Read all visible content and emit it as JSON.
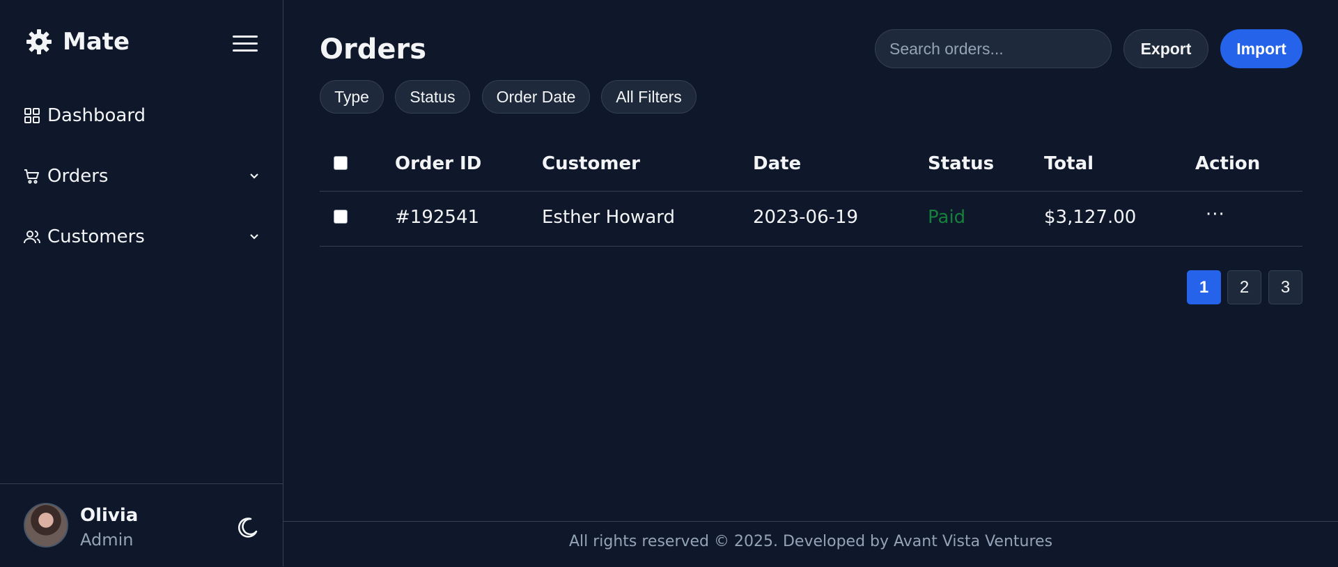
{
  "sidebar": {
    "brand": "Mate",
    "brand_icon": "gear-icon",
    "items": [
      {
        "label": "Dashboard",
        "icon": "grid-icon",
        "expandable": false
      },
      {
        "label": "Orders",
        "icon": "cart-icon",
        "expandable": true
      },
      {
        "label": "Customers",
        "icon": "users-icon",
        "expandable": true
      }
    ],
    "user": {
      "name": "Olivia",
      "role": "Admin"
    }
  },
  "header": {
    "title": "Orders",
    "search_placeholder": "Search orders...",
    "export_label": "Export",
    "import_label": "Import"
  },
  "filters": [
    "Type",
    "Status",
    "Order Date",
    "All Filters"
  ],
  "table": {
    "columns": [
      "Order ID",
      "Customer",
      "Date",
      "Status",
      "Total",
      "Action"
    ],
    "rows": [
      {
        "order_id": "#192541",
        "customer": "Esther Howard",
        "date": "2023-06-19",
        "status": "Paid",
        "total": "$3,127.00",
        "action": "···"
      }
    ]
  },
  "pagination": {
    "pages": [
      "1",
      "2",
      "3"
    ],
    "current": "1"
  },
  "footer": {
    "text": "All rights reserved © 2025. Developed by Avant Vista Ventures"
  },
  "colors": {
    "background": "#0f172a",
    "surface": "#1e293b",
    "border": "#334155",
    "accent": "#2563eb",
    "status_paid": "#15803d",
    "muted_text": "#94a3b8"
  }
}
